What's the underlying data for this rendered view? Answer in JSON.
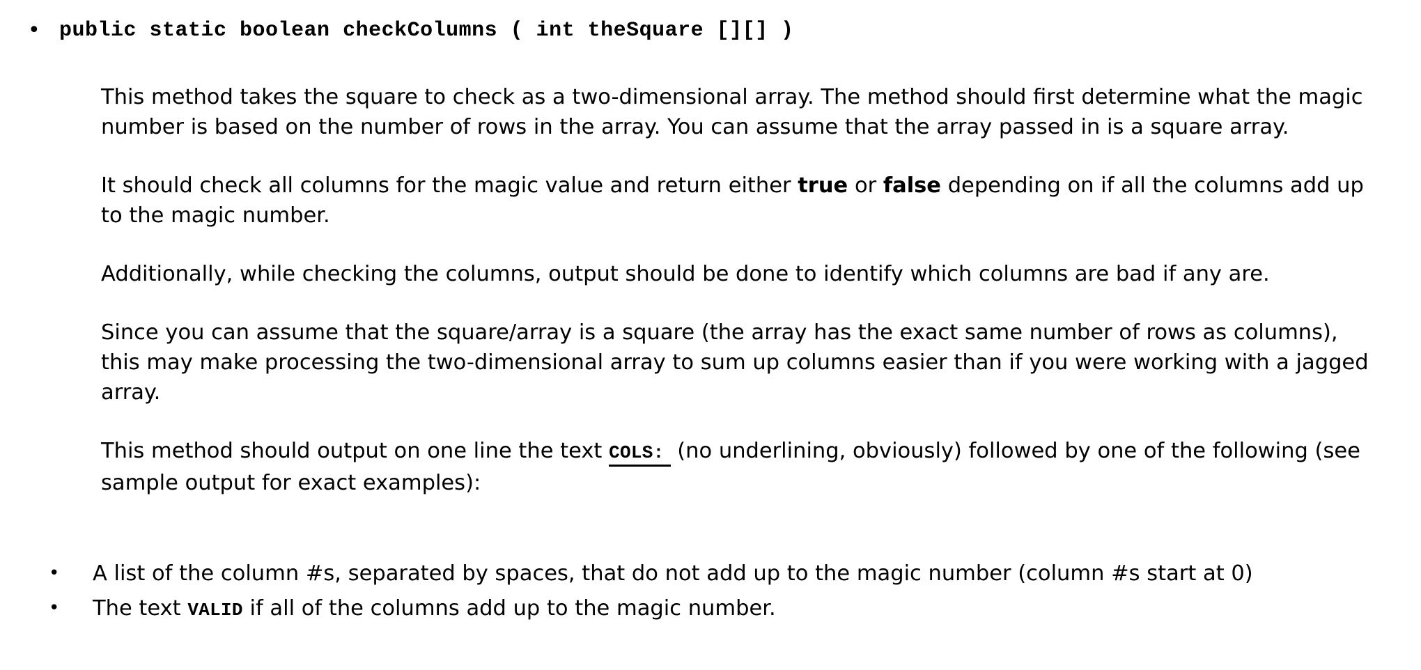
{
  "document": {
    "method_signature": "public static boolean checkColumns ( int theSquare [][] )",
    "bullet_glyph": "•",
    "text_color": "#000000",
    "background_color": "#ffffff",
    "paragraphs": {
      "p1": "This method takes the square to check as a two-dimensional array.  The method should first determine what the magic number is based on the number of rows in the array.  You can assume that the array passed in is a square array.",
      "p2_part1": "It should check all columns for the magic value and return either ",
      "p2_true": "true",
      "p2_part2": " or ",
      "p2_false": "false",
      "p2_part3": " depending on if all the columns add up to the magic number.",
      "p3": "Additionally, while checking the columns, output should be done to identify which columns are bad if any are.",
      "p4": "Since you can assume that the square/array is a square (the array has the exact same number of rows as columns), this may make processing the two-dimensional array to sum up columns easier than if you were working with a jagged array.",
      "p5_part1": "This method should output on one line the text ",
      "p5_code": "COLS:",
      "p5_part2": " (no underlining, obviously) followed by one of the following (see sample output for exact examples):"
    },
    "sub_bullets": [
      {
        "text_before": "A list of the column #s, separated by spaces, that do not add up to the magic number (column #s start at 0)",
        "code": "",
        "text_after": ""
      },
      {
        "text_before": "The text ",
        "code": "VALID",
        "text_after": " if all of the columns add up to the magic number."
      }
    ]
  }
}
